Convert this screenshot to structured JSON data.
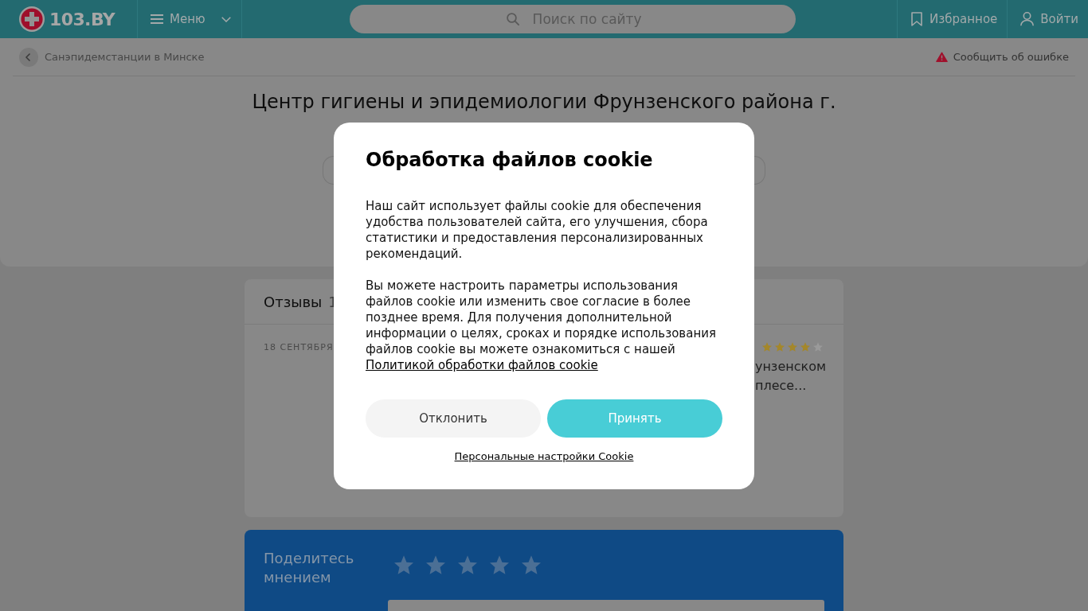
{
  "header": {
    "logo": "103.BY",
    "menu": "Меню",
    "search": {
      "placeholder": "Поиск по сайту"
    },
    "favorites": "Избранное",
    "login": "Войти"
  },
  "breadcrumb": {
    "back_link": "Санэпидемстанции в Минске",
    "report_link": "Сообщить об ошибке"
  },
  "page_title": "Центр гигиены и эпидемиологии Фрунзенского района г.",
  "reviews": {
    "title": "Отзывы",
    "count": "1",
    "items": [
      {
        "date": "18 СЕНТЯБРЯ",
        "stars": 4,
        "text_lines": [
          "унзенском",
          "плесе..."
        ]
      }
    ]
  },
  "share": {
    "title": "Поделитесь мнением"
  },
  "cookie_dialog": {
    "title": "Обработка файлов cookie",
    "paragraphs": [
      {
        "text": "Наш сайт использует файлы cookie для обеспечения удобства пользователей сайта, его улучшения, сбора статистики и предоставления персонализированных рекомендаций."
      },
      {
        "text": "Вы можете настроить параметры использования файлов cookie или изменить свое согласие в более позднее время. Для получения дополнительной информации о целях, сроках и порядке использования файлов cookie вы можете ознакомиться с нашей",
        "link": "Политикой обработки файлов cookie"
      }
    ],
    "buttons": [
      {
        "label": "Отклонить",
        "kind": "secondary"
      },
      {
        "label": "Принять",
        "kind": "primary"
      }
    ],
    "settings_link": "Персональные настройки Cookie"
  }
}
